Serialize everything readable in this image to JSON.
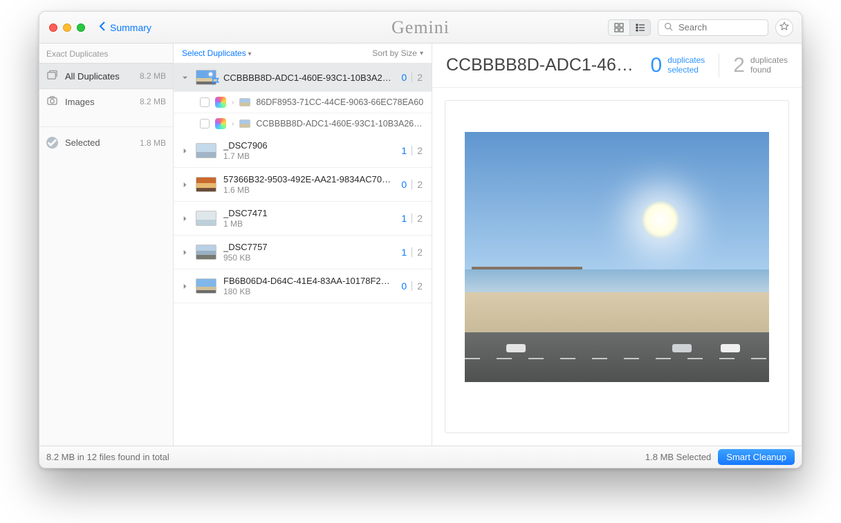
{
  "titlebar": {
    "back_label": "Summary",
    "app_name": "Gemini",
    "search_placeholder": "Search"
  },
  "sidebar": {
    "section": "Exact Duplicates",
    "items": [
      {
        "label": "All Duplicates",
        "size": "8.2 MB"
      },
      {
        "label": "Images",
        "size": "8.2 MB"
      }
    ],
    "selected": {
      "label": "Selected",
      "size": "1.8 MB"
    }
  },
  "mid": {
    "select_label": "Select Duplicates",
    "sort_label": "Sort by Size",
    "groups": [
      {
        "name": "CCBBBB8D-ADC1-460E-93C1-10B3A26…",
        "size": "",
        "sel": "0",
        "tot": "2",
        "expanded": true,
        "children": [
          {
            "name": "86DF8953-71CC-44CE-9063-66EC78EA60"
          },
          {
            "name": "CCBBBB8D-ADC1-460E-93C1-10B3A26621"
          }
        ]
      },
      {
        "name": "_DSC7906",
        "size": "1.7 MB",
        "sel": "1",
        "tot": "2"
      },
      {
        "name": "57366B32-9503-492E-AA21-9834AC70…",
        "size": "1.6 MB",
        "sel": "0",
        "tot": "2"
      },
      {
        "name": "_DSC7471",
        "size": "1 MB",
        "sel": "1",
        "tot": "2"
      },
      {
        "name": "_DSC7757",
        "size": "950 KB",
        "sel": "1",
        "tot": "2"
      },
      {
        "name": "FB6B06D4-D64C-41E4-83AA-10178F25…",
        "size": "180 KB",
        "sel": "0",
        "tot": "2"
      }
    ]
  },
  "preview": {
    "title": "CCBBBB8D-ADC1-46…",
    "sel_count": "0",
    "sel_label_a": "duplicates",
    "sel_label_b": "selected",
    "found_count": "2",
    "found_label_a": "duplicates",
    "found_label_b": "found"
  },
  "footer": {
    "summary": "8.2 MB in 12 files found in total",
    "selected": "1.8 MB Selected",
    "cleanup": "Smart Cleanup"
  }
}
